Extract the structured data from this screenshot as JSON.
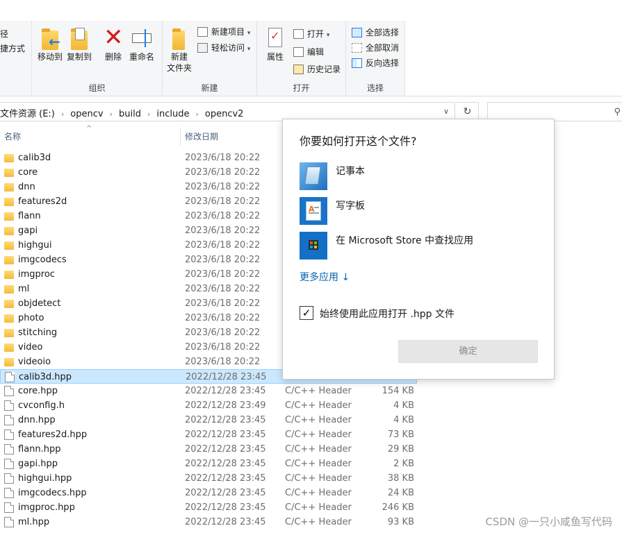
{
  "ribbon": {
    "partial_left_1": "径",
    "partial_left_2": "捷方式",
    "organize": {
      "label": "组织",
      "move_to": "移动到",
      "copy_to": "复制到",
      "delete": "删除",
      "rename": "重命名"
    },
    "new": {
      "label": "新建",
      "new_folder_line1": "新建",
      "new_folder_line2": "文件夹",
      "new_item": "新建项目",
      "easy_access": "轻松访问"
    },
    "open": {
      "label": "打开",
      "properties": "属性",
      "open": "打开",
      "edit": "编辑",
      "history": "历史记录"
    },
    "select": {
      "label": "选择",
      "select_all": "全部选择",
      "select_none": "全部取消",
      "invert": "反向选择"
    }
  },
  "address": {
    "crumbs": [
      "文件资源 (E:)",
      "opencv",
      "build",
      "include",
      "opencv2"
    ]
  },
  "columns": {
    "name": "名称",
    "modified": "修改日期"
  },
  "files": [
    {
      "name": "calib3d",
      "date": "2023/6/18 20:22",
      "type": "",
      "size": "",
      "kind": "dir"
    },
    {
      "name": "core",
      "date": "2023/6/18 20:22",
      "type": "",
      "size": "",
      "kind": "dir"
    },
    {
      "name": "dnn",
      "date": "2023/6/18 20:22",
      "type": "",
      "size": "",
      "kind": "dir"
    },
    {
      "name": "features2d",
      "date": "2023/6/18 20:22",
      "type": "",
      "size": "",
      "kind": "dir"
    },
    {
      "name": "flann",
      "date": "2023/6/18 20:22",
      "type": "",
      "size": "",
      "kind": "dir"
    },
    {
      "name": "gapi",
      "date": "2023/6/18 20:22",
      "type": "",
      "size": "",
      "kind": "dir"
    },
    {
      "name": "highgui",
      "date": "2023/6/18 20:22",
      "type": "",
      "size": "",
      "kind": "dir"
    },
    {
      "name": "imgcodecs",
      "date": "2023/6/18 20:22",
      "type": "",
      "size": "",
      "kind": "dir"
    },
    {
      "name": "imgproc",
      "date": "2023/6/18 20:22",
      "type": "",
      "size": "",
      "kind": "dir"
    },
    {
      "name": "ml",
      "date": "2023/6/18 20:22",
      "type": "",
      "size": "",
      "kind": "dir"
    },
    {
      "name": "objdetect",
      "date": "2023/6/18 20:22",
      "type": "",
      "size": "",
      "kind": "dir"
    },
    {
      "name": "photo",
      "date": "2023/6/18 20:22",
      "type": "",
      "size": "",
      "kind": "dir"
    },
    {
      "name": "stitching",
      "date": "2023/6/18 20:22",
      "type": "",
      "size": "",
      "kind": "dir"
    },
    {
      "name": "video",
      "date": "2023/6/18 20:22",
      "type": "",
      "size": "",
      "kind": "dir"
    },
    {
      "name": "videoio",
      "date": "2023/6/18 20:22",
      "type": "",
      "size": "",
      "kind": "dir"
    },
    {
      "name": "calib3d.hpp",
      "date": "2022/12/28 23:45",
      "type": "",
      "size": "",
      "kind": "file",
      "selected": true
    },
    {
      "name": "core.hpp",
      "date": "2022/12/28 23:45",
      "type": "C/C++ Header",
      "size": "154 KB",
      "kind": "file"
    },
    {
      "name": "cvconfig.h",
      "date": "2022/12/28 23:49",
      "type": "C/C++ Header",
      "size": "4 KB",
      "kind": "file"
    },
    {
      "name": "dnn.hpp",
      "date": "2022/12/28 23:45",
      "type": "C/C++ Header",
      "size": "4 KB",
      "kind": "file"
    },
    {
      "name": "features2d.hpp",
      "date": "2022/12/28 23:45",
      "type": "C/C++ Header",
      "size": "73 KB",
      "kind": "file"
    },
    {
      "name": "flann.hpp",
      "date": "2022/12/28 23:45",
      "type": "C/C++ Header",
      "size": "29 KB",
      "kind": "file"
    },
    {
      "name": "gapi.hpp",
      "date": "2022/12/28 23:45",
      "type": "C/C++ Header",
      "size": "2 KB",
      "kind": "file"
    },
    {
      "name": "highgui.hpp",
      "date": "2022/12/28 23:45",
      "type": "C/C++ Header",
      "size": "38 KB",
      "kind": "file"
    },
    {
      "name": "imgcodecs.hpp",
      "date": "2022/12/28 23:45",
      "type": "C/C++ Header",
      "size": "24 KB",
      "kind": "file"
    },
    {
      "name": "imgproc.hpp",
      "date": "2022/12/28 23:45",
      "type": "C/C++ Header",
      "size": "246 KB",
      "kind": "file"
    },
    {
      "name": "ml.hpp",
      "date": "2022/12/28 23:45",
      "type": "C/C++ Header",
      "size": "93 KB",
      "kind": "file"
    }
  ],
  "dialog": {
    "title": "你要如何打开这个文件?",
    "apps": [
      {
        "label": "记事本",
        "icon": "notepad-icon"
      },
      {
        "label": "写字板",
        "icon": "wordpad-icon"
      },
      {
        "label": "在 Microsoft Store 中查找应用",
        "icon": "store-icon"
      }
    ],
    "more_apps": "更多应用 ↓",
    "always_use": "始终使用此应用打开 .hpp 文件",
    "always_checked": true,
    "ok": "确定"
  },
  "watermark": "CSDN @一只小咸鱼写代码",
  "colors": {
    "selection": "#cce8ff",
    "link": "#0063b1",
    "accent": "#0a67c2"
  }
}
